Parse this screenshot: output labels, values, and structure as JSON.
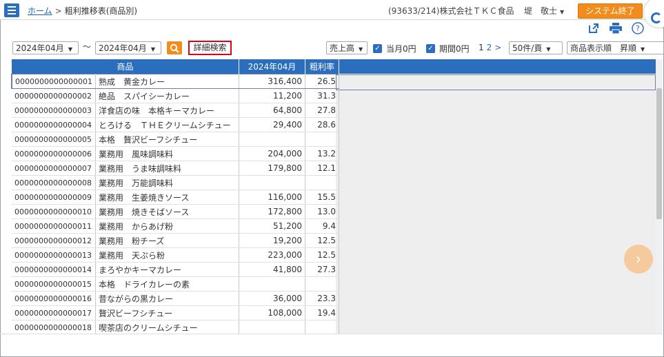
{
  "header": {
    "home_link": "ホーム",
    "breadcrumb_sep": ">",
    "page_title": "粗利推移表(商品別)",
    "company": "(93633/214)株式会社ＴＫＣ食品",
    "user": "堤　敬士",
    "exit_button": "システム終了"
  },
  "icons": [
    "menu-icon",
    "external-link-icon",
    "print-icon",
    "help-icon",
    "search-icon",
    "checkbox-checked-icon",
    "chevron-right-icon"
  ],
  "filters": {
    "period_from": "2024年04月",
    "tilde": "～",
    "period_to": "2024年04月",
    "advanced_search": "詳細検索",
    "metric": "売上高",
    "current_month_zero": "当月0円",
    "period_zero": "期間0円",
    "pager_current": "1",
    "pager_next": "2",
    "pager_next_arrow": ">",
    "per_page": "50件/頁",
    "sort": "商品表示順　昇順"
  },
  "table": {
    "headers": [
      "商品",
      "2024年04月",
      "粗利率"
    ],
    "rows": [
      {
        "code": "0000000000000001",
        "name": "熟成　黄金カレー",
        "amount": "316,400",
        "rate": "26.5"
      },
      {
        "code": "0000000000000002",
        "name": "絶品　スパイシーカレー",
        "amount": "11,200",
        "rate": "31.3"
      },
      {
        "code": "0000000000000003",
        "name": "洋食店の味　本格キーマカレー",
        "amount": "64,800",
        "rate": "27.8"
      },
      {
        "code": "0000000000000004",
        "name": "とろける　ＴＨＥクリームシチュー",
        "amount": "29,400",
        "rate": "28.6"
      },
      {
        "code": "0000000000000005",
        "name": "本格　贅沢ビーフシチュー",
        "amount": "",
        "rate": ""
      },
      {
        "code": "0000000000000006",
        "name": "業務用　風味調味料",
        "amount": "204,000",
        "rate": "13.2"
      },
      {
        "code": "0000000000000007",
        "name": "業務用　うま味調味料",
        "amount": "179,800",
        "rate": "12.1"
      },
      {
        "code": "0000000000000008",
        "name": "業務用　万能調味料",
        "amount": "",
        "rate": ""
      },
      {
        "code": "0000000000000009",
        "name": "業務用　生姜焼きソース",
        "amount": "116,000",
        "rate": "15.5"
      },
      {
        "code": "0000000000000010",
        "name": "業務用　焼きそばソース",
        "amount": "172,800",
        "rate": "13.0"
      },
      {
        "code": "0000000000000011",
        "name": "業務用　からあげ粉",
        "amount": "51,200",
        "rate": "9.4"
      },
      {
        "code": "0000000000000012",
        "name": "業務用　粉チーズ",
        "amount": "19,200",
        "rate": "12.5"
      },
      {
        "code": "0000000000000013",
        "name": "業務用　天ぷら粉",
        "amount": "223,000",
        "rate": "12.5"
      },
      {
        "code": "0000000000000014",
        "name": "まろやかキーマカレー",
        "amount": "41,800",
        "rate": "27.3"
      },
      {
        "code": "0000000000000015",
        "name": "本格　ドライカレーの素",
        "amount": "",
        "rate": ""
      },
      {
        "code": "0000000000000016",
        "name": "昔ながらの黒カレー",
        "amount": "36,000",
        "rate": "23.3"
      },
      {
        "code": "0000000000000017",
        "name": "贅沢ビーフシチュー",
        "amount": "108,000",
        "rate": "19.4"
      },
      {
        "code": "0000000000000018",
        "name": "喫茶店のクリームシチュー",
        "amount": "",
        "rate": ""
      }
    ]
  },
  "colors": {
    "accent": "#2a6ebd",
    "orange": "#f28c1c",
    "highlight_border": "#e0001b"
  }
}
